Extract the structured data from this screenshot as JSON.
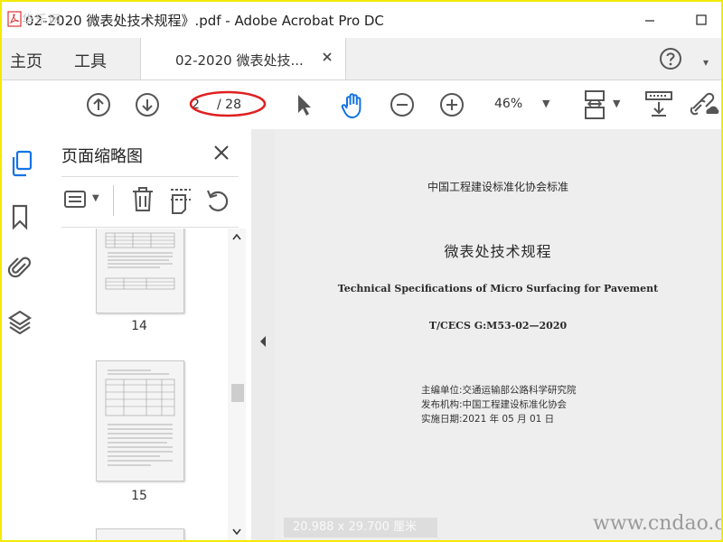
{
  "window": {
    "title": "02-2020 微表处技术规程》.pdf - Adobe Acrobat Pro DC",
    "watermark": "华乐网"
  },
  "tabs": {
    "home": "主页",
    "tools": "工具",
    "document": "02-2020 微表处技..."
  },
  "toolbar": {
    "page_current": "2",
    "page_total": "/ 28",
    "zoom": "46%"
  },
  "panel": {
    "title": "页面缩略图",
    "thumbnails": [
      {
        "label": "14"
      },
      {
        "label": "15"
      }
    ]
  },
  "document": {
    "org_standard": "中国工程建设标准化协会标准",
    "title_cn": "微表处技术规程",
    "title_en": "Technical Specifications of Micro Surfacing for Pavement",
    "code": "T/CECS G:M53-02—2020",
    "editor": "主编单位:交通运输部公路科学研究院",
    "publisher": "发布机构:中国工程建设标准化协会",
    "effective": "实施日期:2021 年 05 月 01 日",
    "dimensions": "20.988 x 29.700 厘米"
  },
  "site_watermark": "www.cndao.com",
  "colors": {
    "frame": "#f4e900",
    "accent_blue": "#1473e6",
    "annotation_red": "#e02020"
  }
}
